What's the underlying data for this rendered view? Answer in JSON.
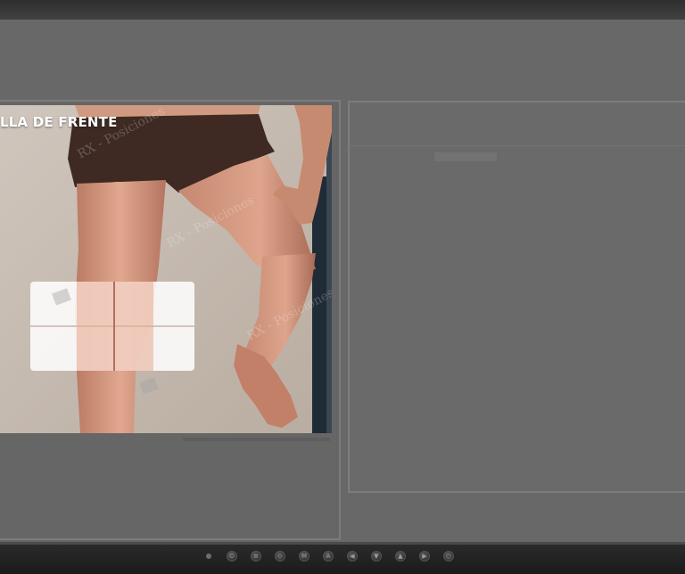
{
  "image_viewer": {
    "label": "LLA DE FRENTE",
    "watermark_text": "RX - Posiciones",
    "image_description_icons": [
      "leg-figure",
      "detector-plate",
      "logo-watermark"
    ]
  },
  "monitor_controls": {
    "buttons": [
      {
        "icon": "power-icon",
        "glyph": "⏻"
      },
      {
        "icon": "menu-icon",
        "glyph": "≡"
      },
      {
        "icon": "source-icon",
        "glyph": "◇"
      },
      {
        "icon": "mode-icon",
        "glyph": "M"
      },
      {
        "icon": "auto-icon",
        "glyph": "A"
      },
      {
        "icon": "left-arrow-icon",
        "glyph": "◀"
      },
      {
        "icon": "down-arrow-icon",
        "glyph": "▼"
      },
      {
        "icon": "up-arrow-icon",
        "glyph": "▲"
      },
      {
        "icon": "right-arrow-icon",
        "glyph": "▶"
      },
      {
        "icon": "exit-icon",
        "glyph": "○"
      }
    ]
  },
  "colors": {
    "screen": "#686868",
    "bezel": "#2a2a2a",
    "detector": "#ffffff",
    "skin": "#d79c85",
    "shorts": "#3e2a22"
  }
}
